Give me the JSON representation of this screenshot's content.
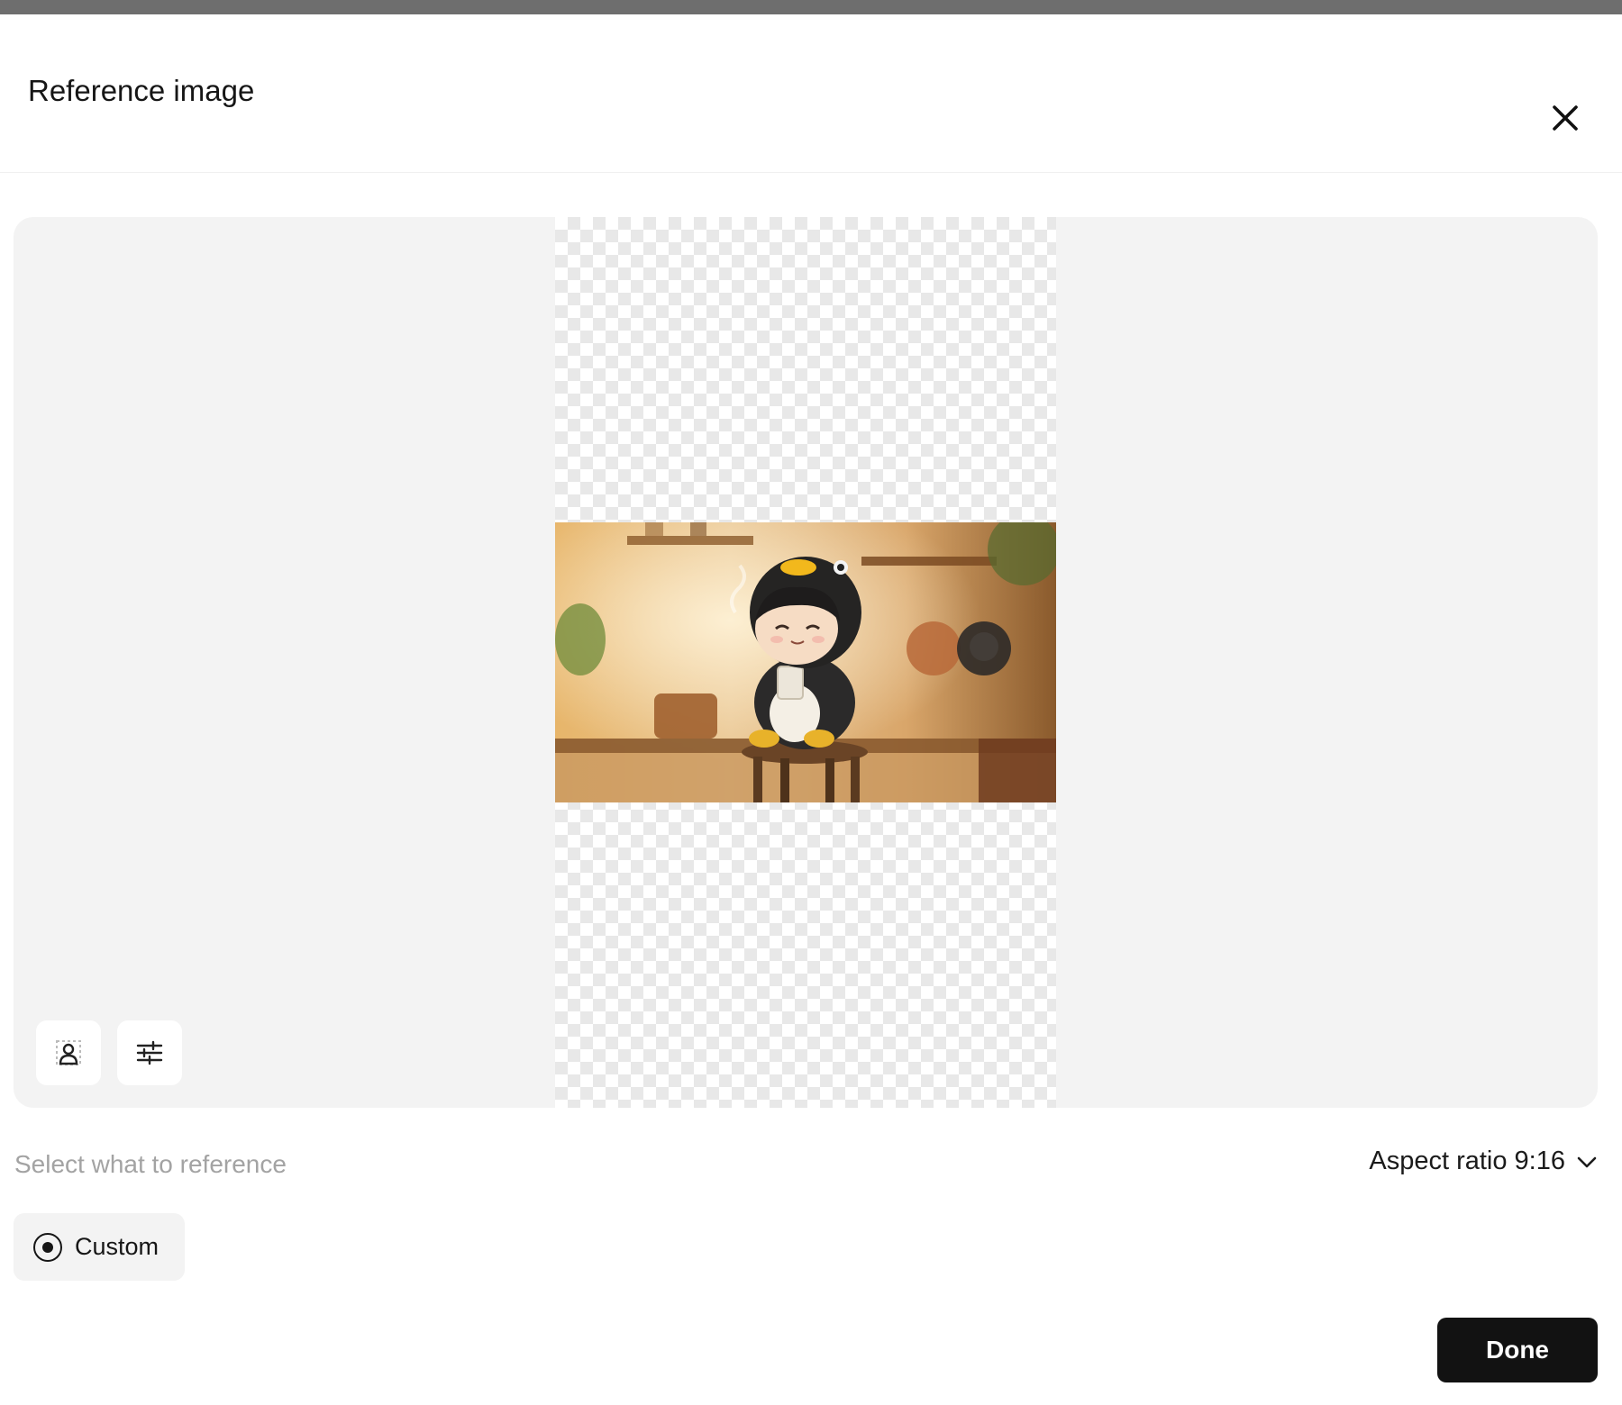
{
  "dialog": {
    "title": "Reference image",
    "close_icon": "close-icon"
  },
  "preview": {
    "image_subject": "chibi girl in penguin costume holding a mug, sitting on a wooden stool in a kitchen",
    "tools": [
      {
        "icon": "subject-select-icon"
      },
      {
        "icon": "sliders-icon"
      }
    ]
  },
  "controls": {
    "select_label": "Select what to reference",
    "aspect_label": "Aspect ratio 9:16",
    "aspect_icon": "chevron-down-icon",
    "options": [
      {
        "label": "Custom",
        "selected": true
      }
    ]
  },
  "footer": {
    "done_label": "Done"
  },
  "colors": {
    "accent": "#121212",
    "canvas_bg": "#f3f3f3",
    "muted_text": "#a3a3a3"
  }
}
